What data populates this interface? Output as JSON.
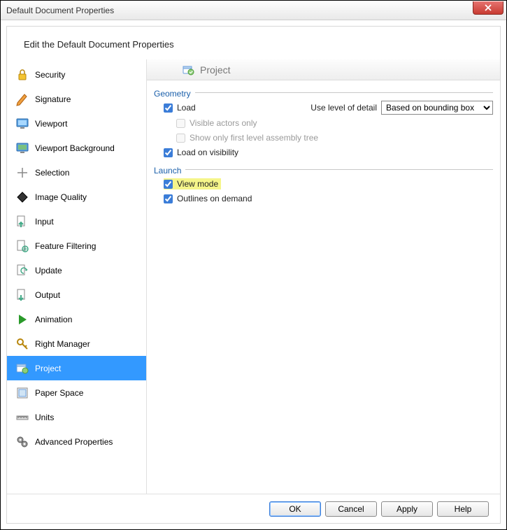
{
  "window": {
    "title": "Default Document Properties"
  },
  "heading": "Edit the Default Document Properties",
  "sidebar": {
    "items": [
      {
        "label": "Security",
        "icon": "lock"
      },
      {
        "label": "Signature",
        "icon": "pen"
      },
      {
        "label": "Viewport",
        "icon": "monitor"
      },
      {
        "label": "Viewport Background",
        "icon": "monitor-bg"
      },
      {
        "label": "Selection",
        "icon": "plus"
      },
      {
        "label": "Image Quality",
        "icon": "diamond"
      },
      {
        "label": "Input",
        "icon": "input"
      },
      {
        "label": "Feature Filtering",
        "icon": "filter"
      },
      {
        "label": "Update",
        "icon": "update"
      },
      {
        "label": "Output",
        "icon": "output"
      },
      {
        "label": "Animation",
        "icon": "play"
      },
      {
        "label": "Right Manager",
        "icon": "key"
      },
      {
        "label": "Project",
        "icon": "project",
        "selected": true
      },
      {
        "label": "Paper Space",
        "icon": "paper"
      },
      {
        "label": "Units",
        "icon": "ruler"
      },
      {
        "label": "Advanced Properties",
        "icon": "gears"
      }
    ]
  },
  "panel": {
    "title": "Project",
    "geometry": {
      "label": "Geometry",
      "load": {
        "label": "Load",
        "checked": true
      },
      "visibleOnly": {
        "label": "Visible actors only",
        "checked": false,
        "disabled": true
      },
      "showFirstLevel": {
        "label": "Show only first level assembly tree",
        "checked": false,
        "disabled": true
      },
      "loadOnVisibility": {
        "label": "Load on visibility",
        "checked": true
      },
      "detailLabel": "Use level of detail",
      "detailValue": "Based on bounding box"
    },
    "launch": {
      "label": "Launch",
      "viewMode": {
        "label": "View mode",
        "checked": true,
        "highlight": true
      },
      "outlines": {
        "label": "Outlines on demand",
        "checked": true
      }
    }
  },
  "buttons": {
    "ok": "OK",
    "cancel": "Cancel",
    "apply": "Apply",
    "help": "Help"
  }
}
